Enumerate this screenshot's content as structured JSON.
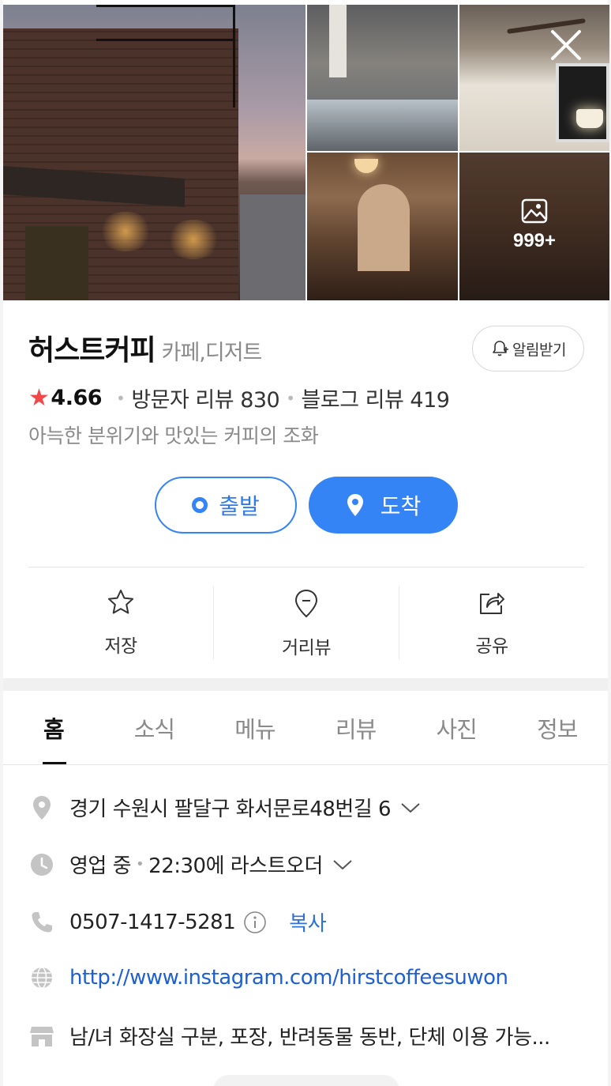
{
  "photos": {
    "more_count": "999+"
  },
  "place": {
    "name": "허스트커피",
    "category": "카페,디저트",
    "alarm_label": "알림받기",
    "rating": "4.66",
    "visitor_reviews": "방문자 리뷰 830",
    "blog_reviews": "블로그 리뷰 419",
    "description": "아늑한 분위기와 맛있는 커피의 조화"
  },
  "route": {
    "start_label": "출발",
    "destination_label": "도착"
  },
  "actions": {
    "save": "저장",
    "street_view": "거리뷰",
    "share": "공유"
  },
  "tabs": [
    {
      "label": "홈"
    },
    {
      "label": "소식"
    },
    {
      "label": "메뉴"
    },
    {
      "label": "리뷰"
    },
    {
      "label": "사진"
    },
    {
      "label": "정보"
    }
  ],
  "info": {
    "address": "경기 수원시 팔달구 화서문로48번길 6",
    "hours_status": "영업 중",
    "hours_detail": "22:30에 라스트오더",
    "phone": "0507-1417-5281",
    "copy_label": "복사",
    "website": "http://www.instagram.com/hirstcoffeesuwon",
    "amenities": "남/녀 화장실 구분, 포장, 반려동물 동반, 단체 이용 가능..."
  },
  "colors": {
    "accent": "#3484f5",
    "star": "#f04848",
    "link": "#1e5fd0"
  }
}
